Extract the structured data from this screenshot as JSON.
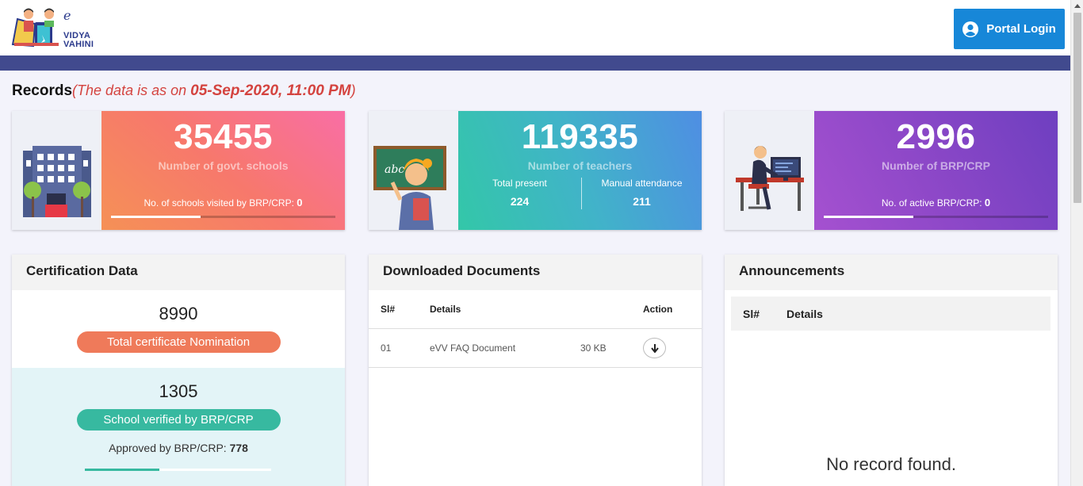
{
  "header": {
    "logo_letter": "e",
    "logo_line1": "VIDYA",
    "logo_line2": "VAHINI",
    "login_label": "Portal Login",
    "login_icon": "user-circle-icon"
  },
  "records": {
    "title": "Records",
    "note_prefix": "(The data is as on ",
    "date": "05-Sep-2020, 11:00 PM",
    "note_suffix": ")"
  },
  "cards": {
    "schools": {
      "value": "35455",
      "label": "Number of govt. schools",
      "footer_label": "No. of schools visited by BRP/CRP: ",
      "footer_value": "0",
      "progress": 0.4,
      "icon": "school-building-icon"
    },
    "teachers": {
      "value": "119335",
      "label": "Number of teachers",
      "present_label": "Total present",
      "present_value": "224",
      "manual_label": "Manual attendance",
      "manual_value": "211",
      "icon": "teacher-icon"
    },
    "brp": {
      "value": "2996",
      "label": "Number of BRP/CRP",
      "footer_label": "No. of active BRP/CRP: ",
      "footer_value": "0",
      "progress": 0.4,
      "icon": "computer-worker-icon"
    }
  },
  "certification": {
    "title": "Certification Data",
    "nominations_value": "8990",
    "nominations_label": "Total certificate Nomination",
    "verified_value": "1305",
    "verified_label": "School verified by BRP/CRP",
    "approved_label": "Approved by BRP/CRP: ",
    "approved_value": "778",
    "progress": 0.4
  },
  "documents": {
    "title": "Downloaded Documents",
    "columns": [
      "Sl#",
      "Details",
      "Action"
    ],
    "rows": [
      {
        "sl": "01",
        "details": "eVV FAQ Document",
        "size": "30 KB",
        "action_icon": "download-arrow-icon"
      }
    ]
  },
  "announcements": {
    "title": "Announcements",
    "columns": [
      "Sl#",
      "Details"
    ],
    "empty_text": "No record found."
  },
  "colors": {
    "nav_bar": "#414a8e",
    "login_button": "#1787d8",
    "accent_red": "#d4433f",
    "teal": "#37b9a0",
    "salmon": "#ef7a5a"
  }
}
